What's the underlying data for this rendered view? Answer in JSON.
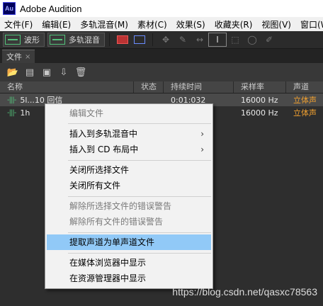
{
  "app": {
    "title": "Adobe Audition",
    "icon_text": "Au"
  },
  "menu": [
    "文件(F)",
    "编辑(E)",
    "多轨混音(M)",
    "素材(C)",
    "效果(S)",
    "收藏夹(R)",
    "视图(V)",
    "窗口(W)"
  ],
  "toolbar": {
    "waveform_label": "波形",
    "multitrack_label": "多轨混音"
  },
  "panel": {
    "tab_label": "文件",
    "tab_close": "×"
  },
  "columns": {
    "name": "名称",
    "status": "状态",
    "duration": "持续时间",
    "sample_rate": "采样率",
    "channels": "声道"
  },
  "files": [
    {
      "name": "5l...10 回信",
      "status": "",
      "duration": "0:01:032",
      "sample_rate": "16000 Hz",
      "channels": "立体声"
    },
    {
      "name": "1h",
      "status": "",
      "duration": "",
      "sample_rate": "16000 Hz",
      "channels": "立体声"
    }
  ],
  "context_menu": {
    "edit_file": "编辑文件",
    "insert_multitrack": "插入到多轨混音中",
    "insert_cd": "插入到 CD 布局中",
    "close_selected": "关闭所选择文件",
    "close_all": "关闭所有文件",
    "dismiss_selected_errors": "解除所选择文件的错误警告",
    "dismiss_all_errors": "解除所有文件的错误警告",
    "extract_mono": "提取声道为单声道文件",
    "show_media_browser": "在媒体浏览器中显示",
    "show_explorer": "在资源管理器中显示",
    "submenu_arrow": "›"
  },
  "watermark": "https://blog.csdn.net/qasxc78563"
}
